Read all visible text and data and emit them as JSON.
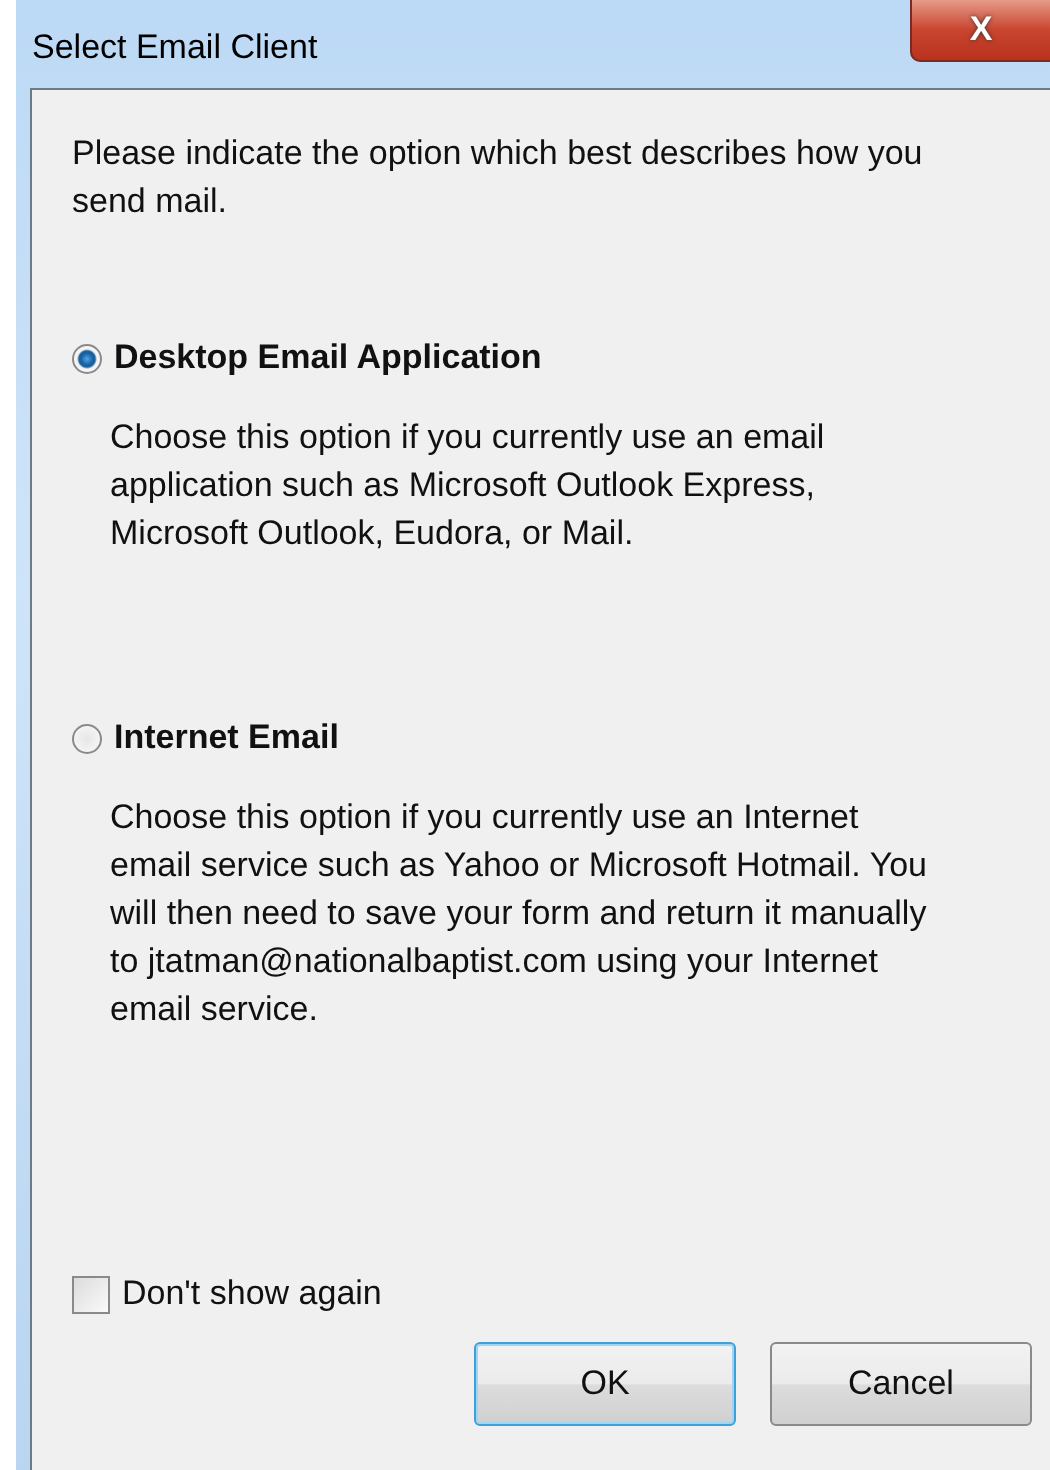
{
  "window": {
    "title": "Select Email Client",
    "close_label": "X"
  },
  "intro": "Please indicate the option which best describes how you send mail.",
  "options": [
    {
      "label": "Desktop Email Application",
      "selected": true,
      "description": "Choose this option if you currently use an email application such as Microsoft Outlook Express, Microsoft Outlook, Eudora, or Mail."
    },
    {
      "label": "Internet Email",
      "selected": false,
      "description": "Choose this option if you currently use an Internet email service such as Yahoo or Microsoft Hotmail. You will then need to save your form and return it manually to jtatman@nationalbaptist.com using your Internet email service."
    }
  ],
  "dont_show_again": {
    "label": "Don't show again",
    "checked": false
  },
  "buttons": [
    {
      "label": "OK",
      "default": true
    },
    {
      "label": "Cancel",
      "default": false
    }
  ]
}
